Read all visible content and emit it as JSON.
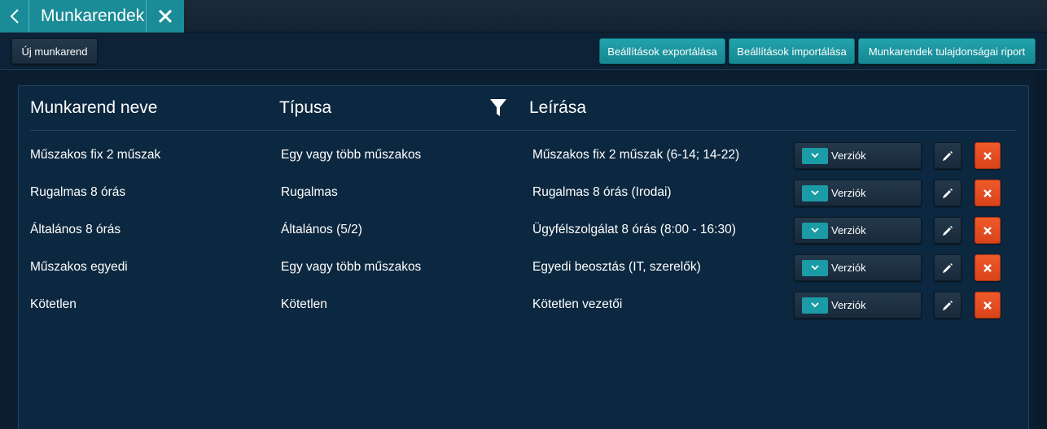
{
  "tab": {
    "title": "Munkarendek"
  },
  "toolbar": {
    "new_label": "Új munkarend",
    "export_label": "Beállítások exportálása",
    "import_label": "Beállítások importálása",
    "report_label": "Munkarendek tulajdonságai riport"
  },
  "table": {
    "headers": {
      "name": "Munkarend neve",
      "type": "Típusa",
      "description": "Leírása"
    },
    "version_label": "Verziók",
    "rows": [
      {
        "name": "Műszakos fix 2 műszak",
        "type": "Egy vagy több műszakos",
        "description": "Műszakos fix 2 műszak (6-14; 14-22)"
      },
      {
        "name": "Rugalmas 8 órás",
        "type": "Rugalmas",
        "description": "Rugalmas 8 órás (Irodai)"
      },
      {
        "name": "Általános 8 órás",
        "type": "Általános (5/2)",
        "description": "Ügyfélszolgálat 8 órás (8:00 - 16:30)"
      },
      {
        "name": "Műszakos egyedi",
        "type": "Egy vagy több műszakos",
        "description": "Egyedi beosztás (IT, szerelők)"
      },
      {
        "name": "Kötetlen",
        "type": "Kötetlen",
        "description": "Kötetlen vezetői"
      }
    ]
  },
  "icons": {
    "back": "chevron-left-icon",
    "close": "close-icon",
    "filter": "filter-icon",
    "chevron": "chevron-down-icon",
    "edit": "pencil-icon",
    "delete": "delete-x-icon"
  },
  "colors": {
    "accent": "#1a8c97",
    "delete": "#e04e22",
    "background": "#0b1e30",
    "panel": "#0c2840"
  }
}
